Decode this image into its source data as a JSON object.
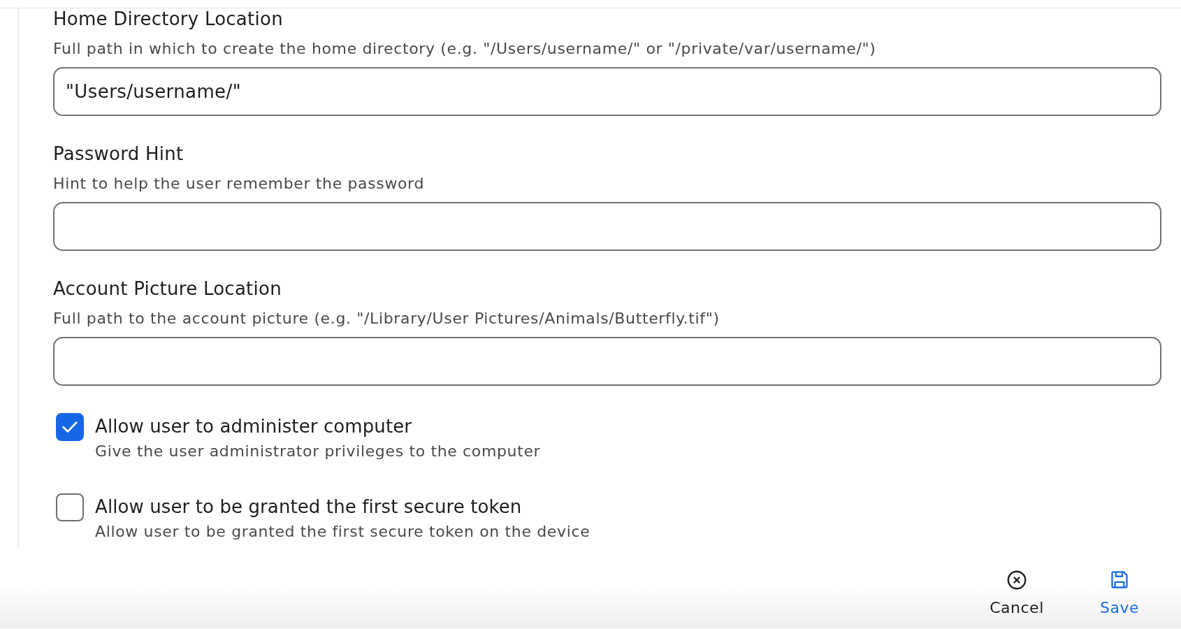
{
  "fields": [
    {
      "label": "Home Directory Location",
      "description": "Full path in which to create the home directory (e.g. \"/Users/username/\" or \"/private/var/username/\")",
      "value": "\"Users/username/\""
    },
    {
      "label": "Password Hint",
      "description": "Hint to help the user remember the password"
    },
    {
      "label": "Account Picture Location",
      "description": "Full path to the account picture (e.g. \"/Library/User Pictures/Animals/Butterfly.tif\")"
    }
  ],
  "checkboxes": [
    {
      "label": "Allow user to administer computer",
      "description": "Give the user administrator privileges to the computer",
      "checked": true
    },
    {
      "label": "Allow user to be granted the first secure token",
      "description": "Allow user to be granted the first secure token on the device",
      "checked": false
    }
  ],
  "actions": [
    {
      "kind": "cancel",
      "label": "Cancel"
    },
    {
      "kind": "save",
      "label": "Save"
    }
  ]
}
